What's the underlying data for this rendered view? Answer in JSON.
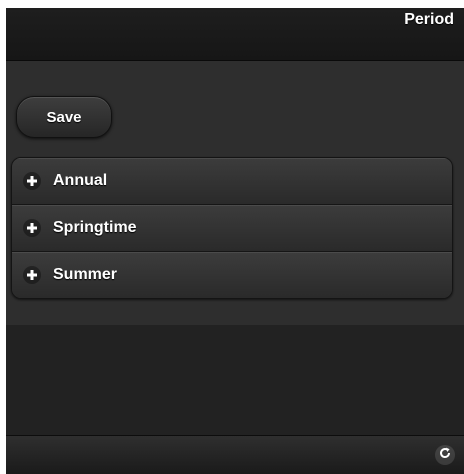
{
  "header": {
    "title": "Period"
  },
  "toolbar": {
    "save_label": "Save"
  },
  "periods": {
    "items": [
      {
        "label": "Annual",
        "icon": "plus-icon"
      },
      {
        "label": "Springtime",
        "icon": "plus-icon"
      },
      {
        "label": "Summer",
        "icon": "plus-icon"
      }
    ]
  },
  "footer": {
    "refresh_icon": "refresh-icon"
  },
  "colors": {
    "background": "#2c2c2c",
    "header": "#181818",
    "text": "#ffffff"
  }
}
